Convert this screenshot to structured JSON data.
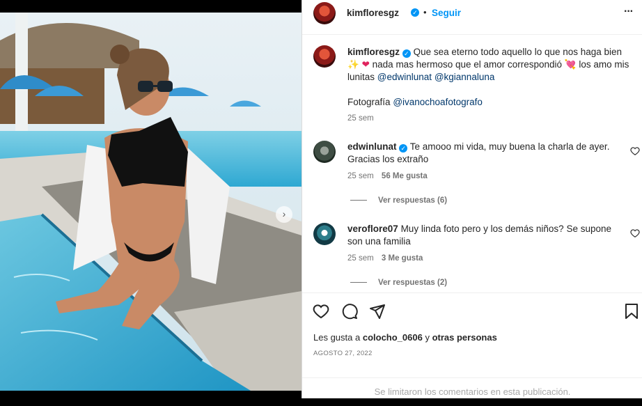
{
  "post": {
    "author": "kimfloresgz",
    "follow_label": "Seguir",
    "dot": "•",
    "more_label": "···"
  },
  "caption": {
    "username": "kimfloresgz",
    "text_part1": "Que sea eterno todo aquello lo que nos haga bien",
    "emoji1": "✨",
    "emoji2": "❤",
    "text_part2": "nada mas hermoso que el amor correspondió",
    "emoji3": "💘",
    "text_part3": "los amo mis lunitas",
    "mention1": "@edwinlunat",
    "mention2": "@kgiannaluna",
    "photo_label": "Fotografía",
    "mention3": "@ivanochoafotografo",
    "time": "25 sem"
  },
  "comments": [
    {
      "username": "edwinlunat",
      "verified": true,
      "text": "Te amooo mi vida, muy buena la charla de ayer. Gracias los extraño",
      "time": "25 sem",
      "likes": "56 Me gusta",
      "replies": "Ver respuestas (6)"
    },
    {
      "username": "veroflore07",
      "verified": false,
      "text": "Muy linda foto pero y los demás niños? Se supone son una familia",
      "time": "25 sem",
      "likes": "3 Me gusta",
      "replies": "Ver respuestas (2)"
    }
  ],
  "likes_line": {
    "prefix": "Les gusta a",
    "user": "colocho_0606",
    "middle": "y",
    "suffix": "otras personas"
  },
  "date": "AGOSTO 27, 2022",
  "footer": "Se limitaron los comentarios en esta publicación.",
  "carousel": {
    "next_icon": "›",
    "count": 6,
    "active": 0
  },
  "colors": {
    "link": "#0095f6",
    "mention": "#00376b",
    "muted": "#737373"
  },
  "icons": [
    "heart-icon",
    "comment-icon",
    "share-icon",
    "bookmark-icon",
    "more-icon",
    "verified-icon"
  ]
}
